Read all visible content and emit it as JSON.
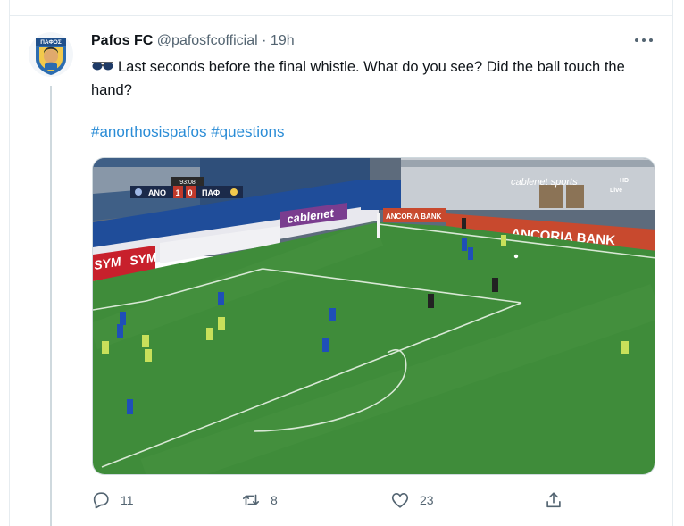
{
  "tweet": {
    "author_name": "Pafos FC",
    "author_handle": "@pafosfcofficial",
    "separator": "·",
    "time": "19h",
    "text": "Last seconds before the final whistle. What do you see? Did the ball touch the hand?",
    "emoji_icon": "sunglasses-icon",
    "hashtags": [
      "#anorthosispafos",
      "#questions"
    ],
    "avatar_text": "ΠΑΦΟΣ"
  },
  "media": {
    "scoreboard": {
      "clock": "93:08",
      "home": "ΑΝΟ",
      "home_score": "1",
      "away_score": "0",
      "away": "ΠΑΦ"
    },
    "broadcaster": "cablenet sports",
    "broadcaster_hd": "HD",
    "broadcaster_live": "Live",
    "ad_cablenet": "cablenet",
    "ad_sym_1": "SYM",
    "ad_sym_2": "SYM",
    "ad_ancoria_small": "ANCORIA BANK",
    "ad_ancoria_large": "ANCORIA BANK"
  },
  "actions": {
    "reply_count": "11",
    "retweet_count": "8",
    "like_count": "23"
  },
  "colors": {
    "hashtag": "#2a8cd6",
    "muted": "#536471",
    "pitch": "#3f8c3a"
  }
}
